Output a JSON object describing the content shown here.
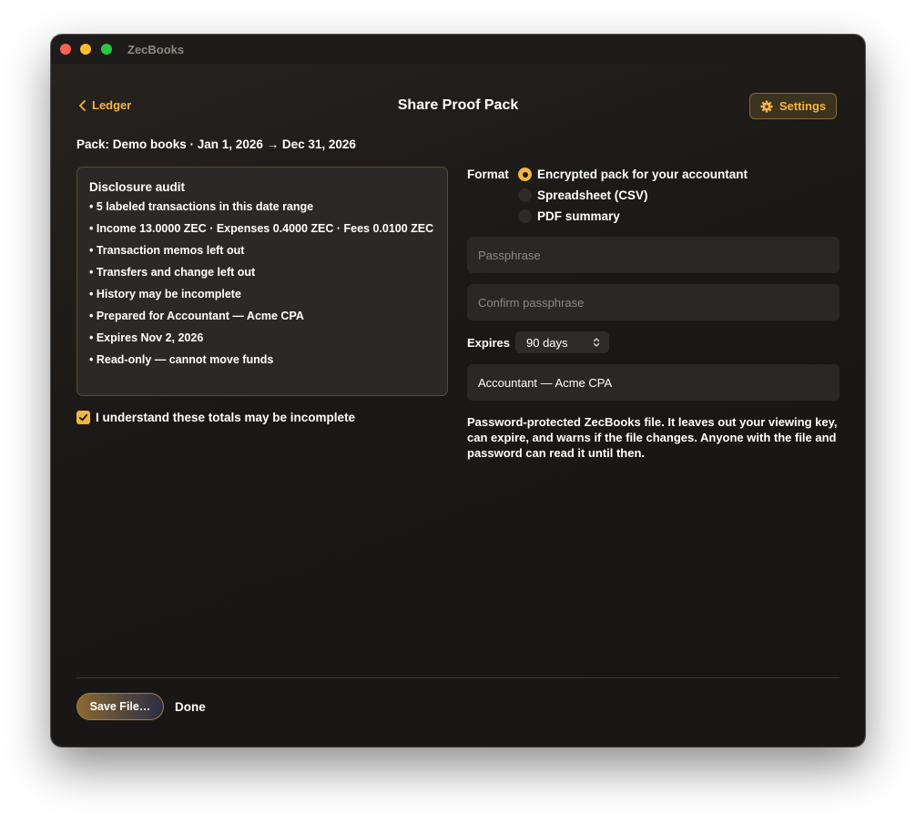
{
  "window": {
    "app_title": "ZecBooks",
    "page_title": "Share Proof Pack",
    "back_label": "Ledger",
    "settings_label": "Settings"
  },
  "pack": {
    "label": "Pack: Demo books · Jan 1, 2026 → Dec 31, 2026"
  },
  "audit": {
    "title": "Disclosure audit",
    "items": [
      "• 5 labeled transactions in this date range",
      "• Income 13.0000 ZEC · Expenses 0.4000 ZEC · Fees 0.0100 ZEC",
      "• Transaction memos left out",
      "• Transfers and change left out",
      "• History may be incomplete",
      "• Prepared for Accountant — Acme CPA",
      "• Expires Nov 2, 2026",
      "• Read-only — cannot move funds"
    ]
  },
  "acknowledge": {
    "label": "I understand these totals may be incomplete",
    "checked": true
  },
  "format": {
    "label": "Format",
    "options": [
      "Encrypted pack for your accountant",
      "Spreadsheet (CSV)",
      "PDF summary"
    ],
    "selected": "Encrypted pack for your accountant"
  },
  "passphrase": {
    "placeholder": "Passphrase",
    "confirm_placeholder": "Confirm passphrase"
  },
  "expires": {
    "label": "Expires",
    "value": "90 days"
  },
  "recipient": {
    "value": "Accountant — Acme CPA"
  },
  "description": "Password-protected ZecBooks file. It leaves out your viewing key, can expire, and warns if the file changes. Anyone with the file and password can read it until then.",
  "footer": {
    "save_label": "Save File…",
    "done_label": "Done"
  },
  "colors": {
    "accent": "#f2b543",
    "window_bg": "#1a1816",
    "field_bg": "#2a2826"
  }
}
